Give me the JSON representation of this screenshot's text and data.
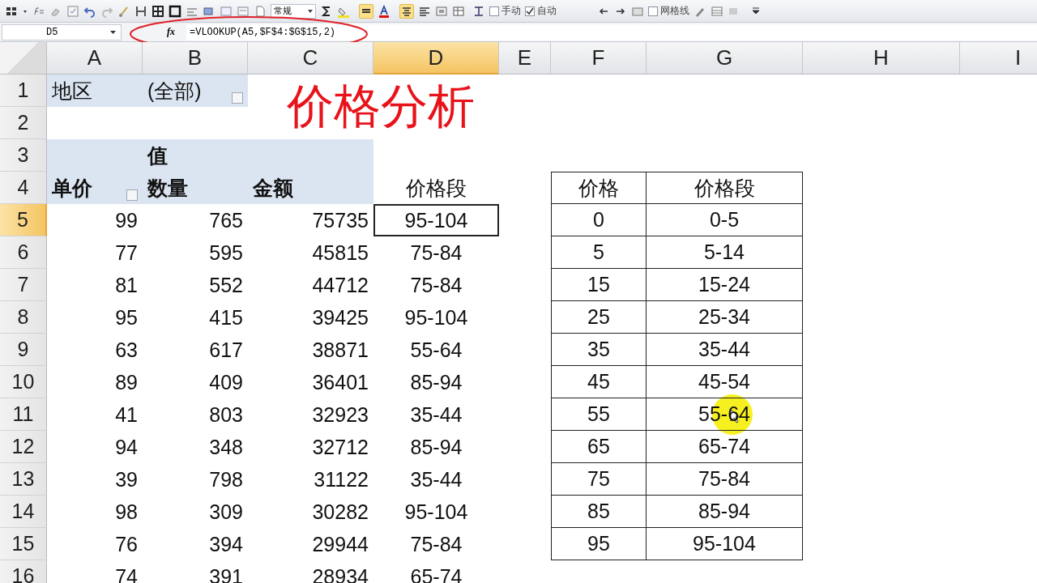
{
  "toolbar": {
    "number_format": "常规",
    "checkboxes": [
      {
        "label": "手动",
        "checked": false
      },
      {
        "label": "自动",
        "checked": true
      },
      {
        "label": "网格线",
        "checked": false
      }
    ]
  },
  "formula_bar": {
    "name_box": "D5",
    "fx": "fx",
    "formula": "=VLOOKUP(A5,$F$4:$G$15,2)"
  },
  "columns": [
    {
      "label": "A",
      "selected": false
    },
    {
      "label": "B",
      "selected": false
    },
    {
      "label": "C",
      "selected": false
    },
    {
      "label": "D",
      "selected": true
    },
    {
      "label": "E",
      "selected": false
    },
    {
      "label": "F",
      "selected": false
    },
    {
      "label": "G",
      "selected": false
    },
    {
      "label": "H",
      "selected": false
    },
    {
      "label": "I",
      "selected": false
    }
  ],
  "row_headers": [
    {
      "label": "1",
      "selected": false
    },
    {
      "label": "2",
      "selected": false
    },
    {
      "label": "3",
      "selected": false
    },
    {
      "label": "4",
      "selected": false
    },
    {
      "label": "5",
      "selected": true
    },
    {
      "label": "6",
      "selected": false
    },
    {
      "label": "7",
      "selected": false
    },
    {
      "label": "8",
      "selected": false
    },
    {
      "label": "9",
      "selected": false
    },
    {
      "label": "10",
      "selected": false
    },
    {
      "label": "11",
      "selected": false
    },
    {
      "label": "12",
      "selected": false
    },
    {
      "label": "13",
      "selected": false
    },
    {
      "label": "14",
      "selected": false
    },
    {
      "label": "15",
      "selected": false
    },
    {
      "label": "16",
      "selected": false
    }
  ],
  "title": "价格分析",
  "pivot": {
    "filter": {
      "field": "地区",
      "value": "(全部)"
    },
    "values_label": "值",
    "headers": [
      "单价",
      "数量",
      "金额"
    ],
    "rows": [
      [
        "99",
        "765",
        "75735"
      ],
      [
        "77",
        "595",
        "45815"
      ],
      [
        "81",
        "552",
        "44712"
      ],
      [
        "95",
        "415",
        "39425"
      ],
      [
        "63",
        "617",
        "38871"
      ],
      [
        "89",
        "409",
        "36401"
      ],
      [
        "41",
        "803",
        "32923"
      ],
      [
        "94",
        "348",
        "32712"
      ],
      [
        "39",
        "798",
        "31122"
      ],
      [
        "98",
        "309",
        "30282"
      ],
      [
        "76",
        "394",
        "29944"
      ],
      [
        "74",
        "391",
        "28934"
      ]
    ]
  },
  "result_column": {
    "header": "价格段",
    "values": [
      {
        "text": "95-104",
        "selected": true
      },
      {
        "text": "75-84",
        "selected": false
      },
      {
        "text": "75-84",
        "selected": false
      },
      {
        "text": "95-104",
        "selected": false
      },
      {
        "text": "55-64",
        "selected": false
      },
      {
        "text": "85-94",
        "selected": false
      },
      {
        "text": "35-44",
        "selected": false
      },
      {
        "text": "85-94",
        "selected": false
      },
      {
        "text": "35-44",
        "selected": false
      },
      {
        "text": "95-104",
        "selected": false
      },
      {
        "text": "75-84",
        "selected": false
      },
      {
        "text": "65-74",
        "selected": false
      }
    ]
  },
  "lookup_table": {
    "headers": [
      "价格",
      "价格段"
    ],
    "rows": [
      [
        "0",
        "0-5"
      ],
      [
        "5",
        "5-14"
      ],
      [
        "15",
        "15-24"
      ],
      [
        "25",
        "25-34"
      ],
      [
        "35",
        "35-44"
      ],
      [
        "45",
        "45-54"
      ],
      [
        "55",
        "55-64"
      ],
      [
        "65",
        "65-74"
      ],
      [
        "75",
        "75-84"
      ],
      [
        "85",
        "85-94"
      ],
      [
        "95",
        "95-104"
      ]
    ]
  }
}
